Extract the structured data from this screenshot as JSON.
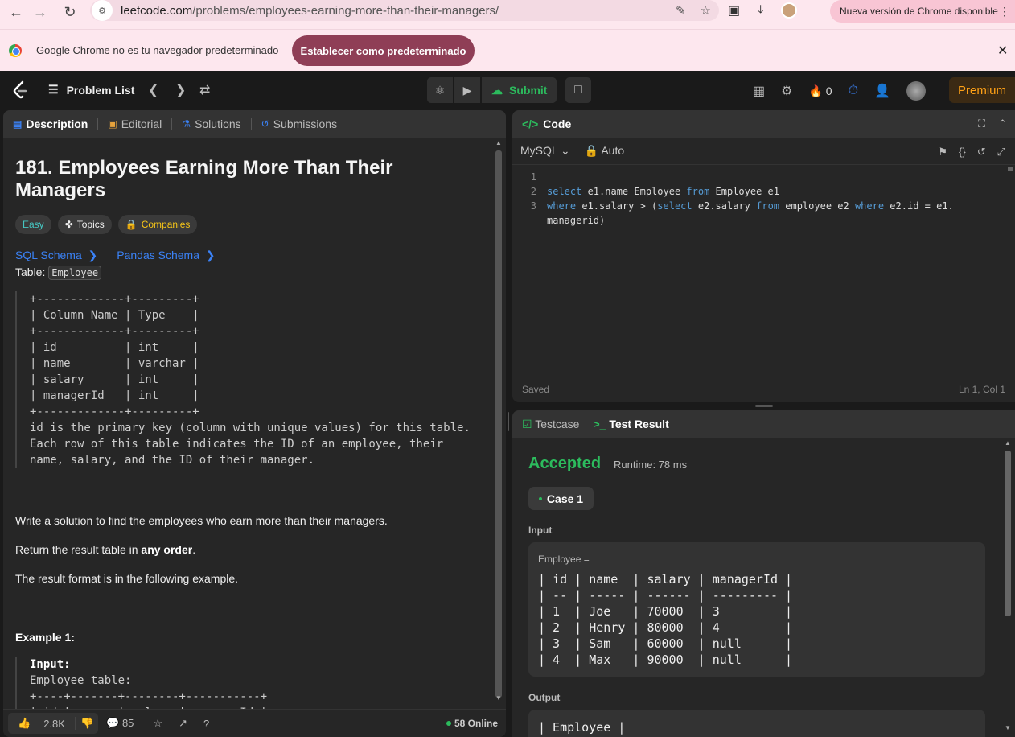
{
  "browser": {
    "url_domain": "leetcode.com",
    "url_path": "/problems/employees-earning-more-than-their-managers/",
    "update_notice": "Nueva versión de Chrome disponible",
    "infobar_message": "Google Chrome no es tu navegador predeterminado",
    "infobar_button": "Establecer como predeterminado"
  },
  "header": {
    "problem_list": "Problem List",
    "submit": "Submit",
    "streak_count": "0",
    "premium": "Premium"
  },
  "left_tabs": [
    "Description",
    "Editorial",
    "Solutions",
    "Submissions"
  ],
  "problem": {
    "title": "181. Employees Earning More Than Their Managers",
    "difficulty": "Easy",
    "topics": "Topics",
    "companies": "Companies",
    "sql_schema": "SQL Schema",
    "pandas_schema": "Pandas Schema",
    "table_label": "Table:",
    "table_name": "Employee",
    "schema_text": "+-------------+---------+\n| Column Name | Type    |\n+-------------+---------+\n| id          | int     |\n| name        | varchar |\n| salary      | int     |\n| managerId   | int     |\n+-------------+---------+\nid is the primary key (column with unique values) for this table.\nEach row of this table indicates the ID of an employee, their\nname, salary, and the ID of their manager.",
    "para1": "Write a solution to find the employees who earn more than their managers.",
    "para2_prefix": "Return the result table in ",
    "para2_bold": "any order",
    "para2_suffix": ".",
    "para3": "The result format is in the following example.",
    "example_label": "Example 1:",
    "example_input_label": "Input:",
    "example_text": "Employee table:\n+----+-------+--------+-----------+\n| id | name  | salary | managerId |"
  },
  "footer": {
    "likes": "2.8K",
    "comments": "85",
    "online": "58 Online"
  },
  "code": {
    "tab": "Code",
    "language": "MySQL",
    "mode": "Auto",
    "lines": [
      {
        "n": "1",
        "tokens": []
      },
      {
        "n": "2",
        "tokens": [
          [
            "kw",
            "select"
          ],
          [
            "t",
            " e1.name Employee "
          ],
          [
            "kw",
            "from"
          ],
          [
            "t",
            " Employee e1"
          ]
        ]
      },
      {
        "n": "3",
        "tokens": [
          [
            "kw",
            "where"
          ],
          [
            "t",
            " e1.salary > ("
          ],
          [
            "kw",
            "select"
          ],
          [
            "t",
            " e2.salary "
          ],
          [
            "kw",
            "from"
          ],
          [
            "t",
            " employee e2 "
          ],
          [
            "kw",
            "where"
          ],
          [
            "t",
            " e2.id = e1."
          ]
        ]
      },
      {
        "n": "",
        "tokens": [
          [
            "t",
            "managerid)"
          ]
        ]
      }
    ],
    "status": "Saved",
    "position": "Ln 1, Col 1"
  },
  "result": {
    "tab_testcase": "Testcase",
    "tab_result": "Test Result",
    "status": "Accepted",
    "runtime": "Runtime: 78 ms",
    "case": "Case 1",
    "input_label": "Input",
    "input_var": "Employee =",
    "input_table": "| id | name  | salary | managerId |\n| -- | ----- | ------ | --------- |\n| 1  | Joe   | 70000  | 3         |\n| 2  | Henry | 80000  | 4         |\n| 3  | Sam   | 60000  | null      |\n| 4  | Max   | 90000  | null      |",
    "output_label": "Output",
    "output_table": "| Employee |"
  },
  "colors": {
    "accent_green": "#2cbb5d",
    "link_blue": "#3b82f6",
    "premium_orange": "#ffa116",
    "keyword_blue": "#569cd6"
  }
}
